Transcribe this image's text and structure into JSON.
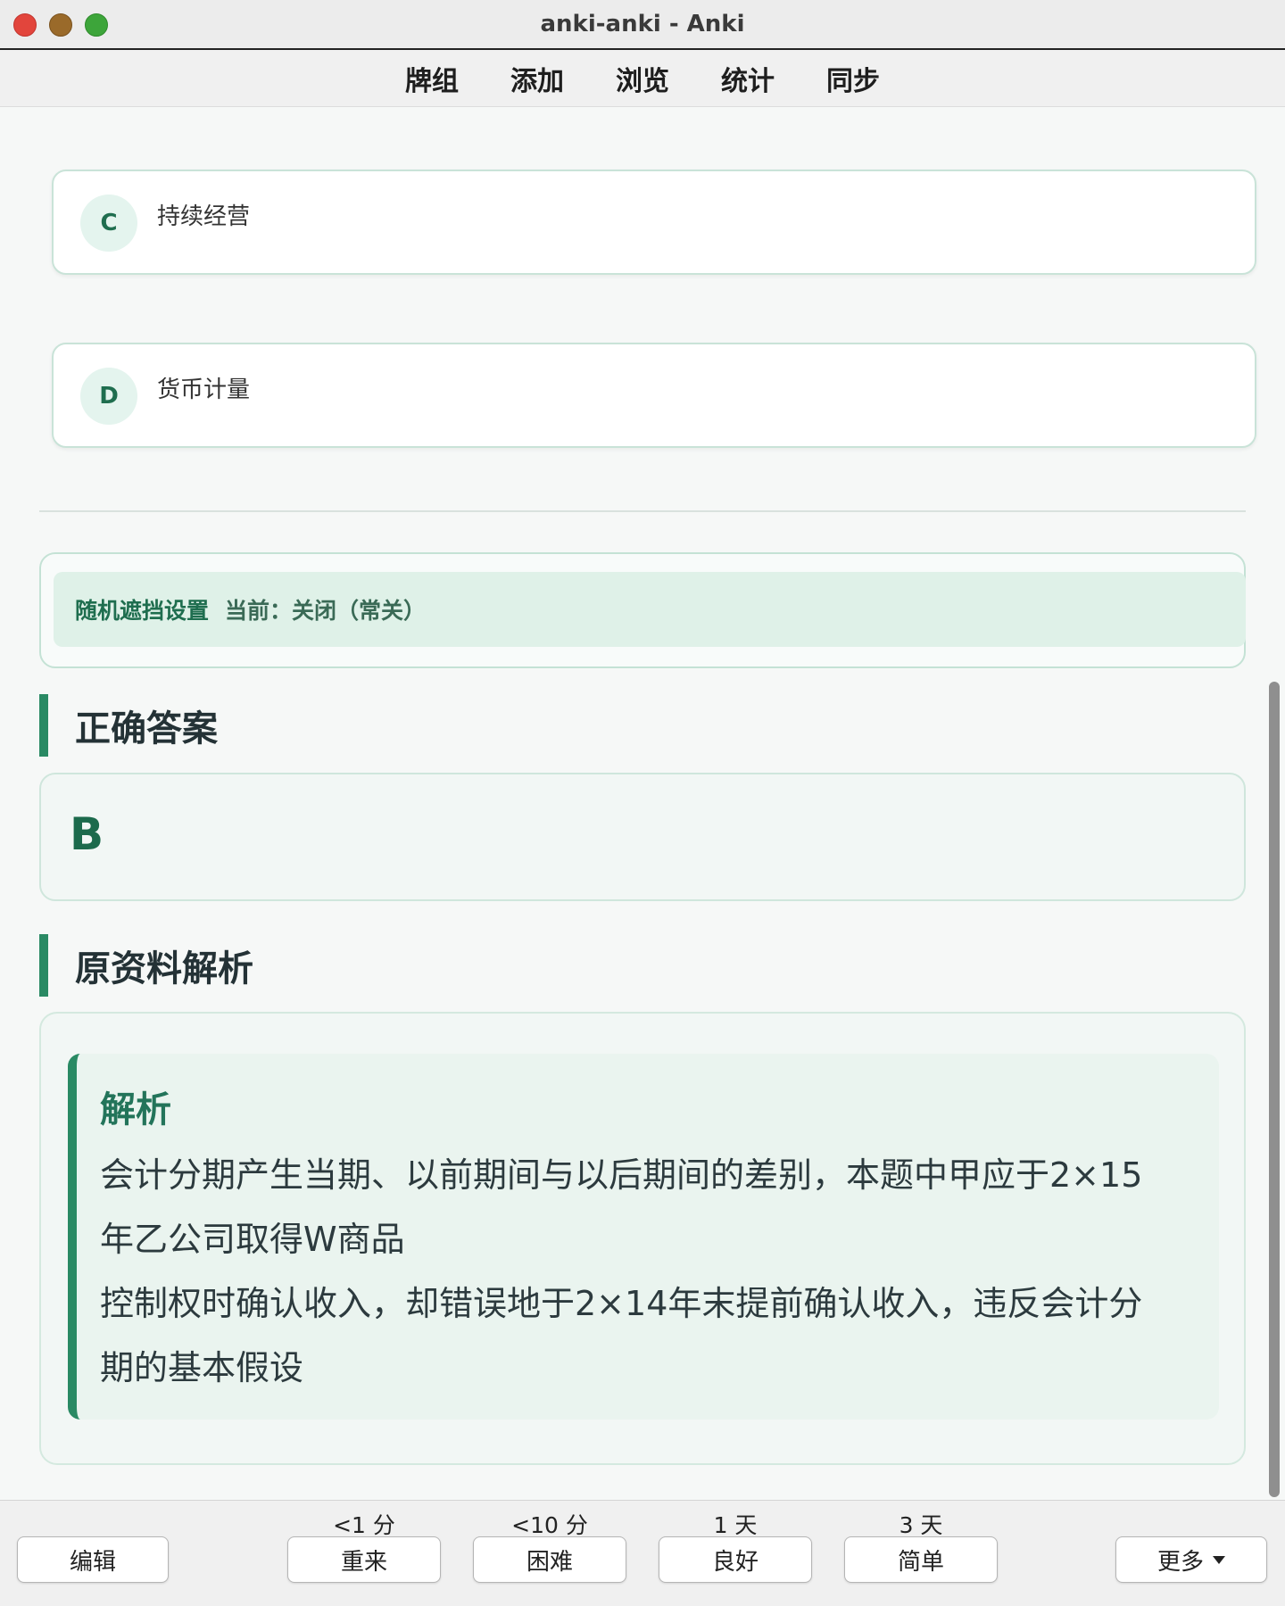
{
  "window": {
    "title": "anki-anki - Anki"
  },
  "nav": {
    "items": [
      "牌组",
      "添加",
      "浏览",
      "统计",
      "同步"
    ]
  },
  "options": [
    {
      "letter": "C",
      "text": "持续经营"
    },
    {
      "letter": "D",
      "text": "货币计量"
    }
  ],
  "mask": {
    "label": "随机遮挡设置",
    "status": "当前：关闭（常关）"
  },
  "answer_section": {
    "title": "正确答案",
    "value": "B"
  },
  "analysis_section": {
    "title": "原资料解析",
    "heading": "解析",
    "lines": [
      "会计分期产生当期、以前期间与以后期间的差别，本题中甲应于2×15",
      "年乙公司取得W商品",
      "控制权时确认收入，却错误地于2×14年末提前确认收入，违反会计分",
      "期的基本假设"
    ]
  },
  "bottom": {
    "edit_label": "编辑",
    "more_label": "更多",
    "answers": [
      {
        "label": "重来",
        "interval": "<1 分"
      },
      {
        "label": "困难",
        "interval": "<10 分"
      },
      {
        "label": "良好",
        "interval": "1 天"
      },
      {
        "label": "简单",
        "interval": "3 天"
      }
    ]
  },
  "colors": {
    "accent": "#2a8a64",
    "accent_light": "#dff1e8",
    "background": "#f6f8f7"
  }
}
